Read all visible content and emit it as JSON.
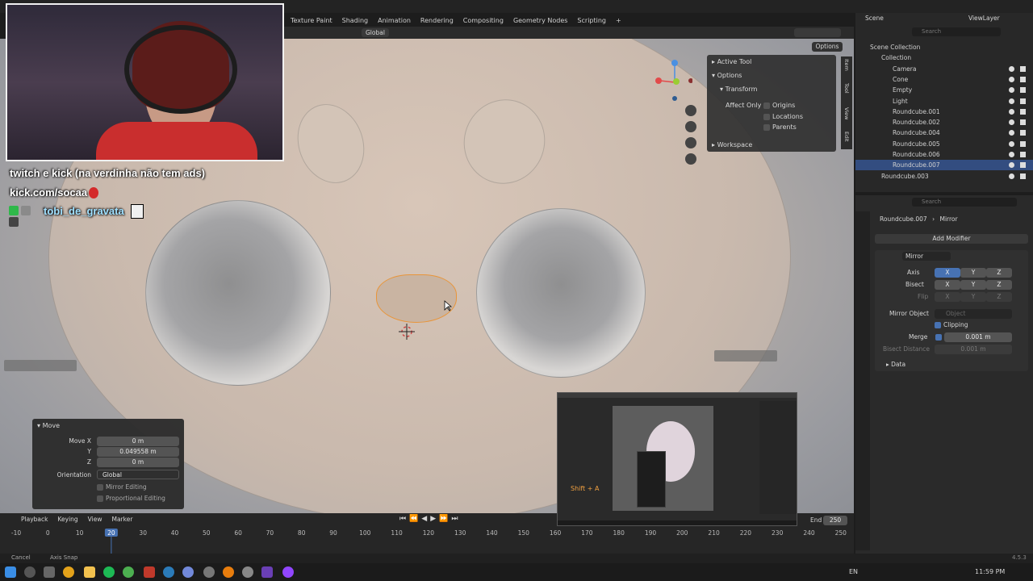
{
  "workspace_tabs": [
    "Texture Paint",
    "Shading",
    "Animation",
    "Rendering",
    "Compositing",
    "Geometry Nodes",
    "Scripting",
    "+"
  ],
  "viewport_header": {
    "orientation": "Global",
    "options_label": "Options"
  },
  "npanel": {
    "active_tool": "Active Tool",
    "options": "Options",
    "transform": "Transform",
    "affect_only": "Affect Only",
    "origins": "Origins",
    "locations": "Locations",
    "parents": "Parents",
    "workspace": "Workspace"
  },
  "npanel_tabs": [
    "Item",
    "Tool",
    "View",
    "Edit"
  ],
  "operator_panel": {
    "title": "Move",
    "move_x_label": "Move X",
    "move_x": "0 m",
    "y_label": "Y",
    "y": "0.049558 m",
    "z_label": "Z",
    "z": "0 m",
    "orientation_label": "Orientation",
    "orientation": "Global",
    "mirror_editing": "Mirror Editing",
    "proportional_editing": "Proportional Editing"
  },
  "outliner": {
    "scene": "Scene",
    "view_layer": "ViewLayer",
    "search_placeholder": "Search",
    "items": [
      {
        "label": "Scene Collection",
        "indent": 0
      },
      {
        "label": "Collection",
        "indent": 1
      },
      {
        "label": "Camera",
        "indent": 2
      },
      {
        "label": "Cone",
        "indent": 2
      },
      {
        "label": "Empty",
        "indent": 2
      },
      {
        "label": "Light",
        "indent": 2
      },
      {
        "label": "Roundcube.001",
        "indent": 2
      },
      {
        "label": "Roundcube.002",
        "indent": 2
      },
      {
        "label": "Roundcube.004",
        "indent": 2
      },
      {
        "label": "Roundcube.005",
        "indent": 2
      },
      {
        "label": "Roundcube.006",
        "indent": 2
      },
      {
        "label": "Roundcube.007",
        "indent": 2,
        "selected": true
      },
      {
        "label": "Roundcube.003",
        "indent": 1
      }
    ]
  },
  "properties": {
    "search_placeholder": "Search",
    "object": "Roundcube.007",
    "modifier_context": "Mirror",
    "add_modifier": "Add Modifier",
    "modifier_name": "Mirror",
    "axis_label": "Axis",
    "bisect_label": "Bisect",
    "flip_label": "Flip",
    "x": "X",
    "y": "Y",
    "z": "Z",
    "mirror_object_label": "Mirror Object",
    "mirror_object_placeholder": "Object",
    "clipping": "Clipping",
    "merge_label": "Merge",
    "merge_value": "0.001 m",
    "bisect_distance_label": "Bisect Distance",
    "bisect_distance_value": "0.001 m",
    "data": "Data"
  },
  "timeline": {
    "menus": [
      "Playback",
      "Keying",
      "View",
      "Marker"
    ],
    "end_label": "End",
    "end_value": "250",
    "current_frame": "20",
    "ticks": [
      "-10",
      "0",
      "10",
      "20",
      "30",
      "40",
      "50",
      "60",
      "70",
      "80",
      "90",
      "100",
      "110",
      "120",
      "130",
      "140",
      "150",
      "160",
      "170",
      "180",
      "190",
      "200",
      "210",
      "220",
      "230",
      "240",
      "250"
    ]
  },
  "statusbar": {
    "cancel": "Cancel",
    "axis_snap": "Axis Snap",
    "version": "4.5.3"
  },
  "overlay": {
    "line1": "twitch e kick (na verdinha não tem ads)",
    "line2": "kick.com/socaa",
    "line3": "tobi_de_gravata"
  },
  "pip": {
    "hint": "Shift + A"
  },
  "taskbar": {
    "lang": "EN",
    "time": "11:59 PM"
  }
}
